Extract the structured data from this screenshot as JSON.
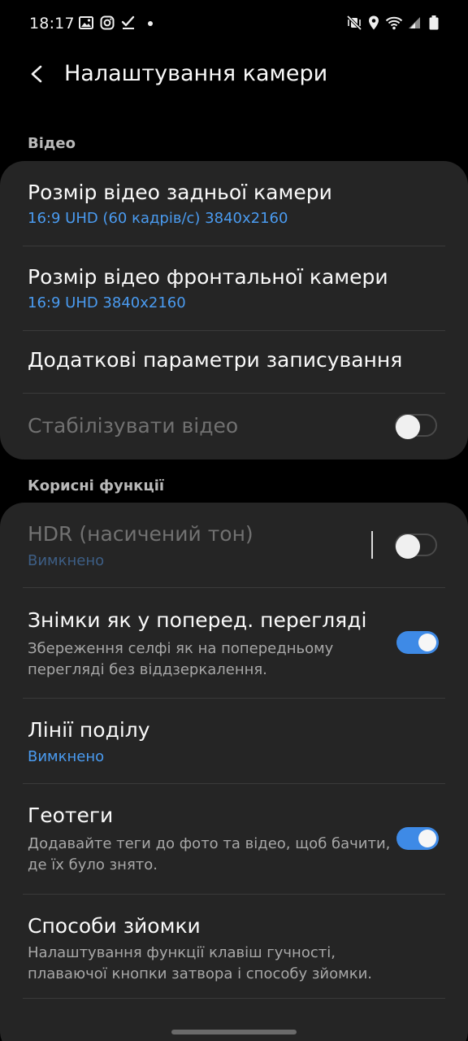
{
  "status_bar": {
    "time": "18:17",
    "left_icons": [
      "image-icon",
      "instagram-icon",
      "check-icon",
      "dot-icon"
    ],
    "right_icons": [
      "mute-vibrate-icon",
      "location-icon",
      "wifi-icon",
      "signal-icon",
      "battery-icon"
    ]
  },
  "header": {
    "back_icon": "arrow-back-icon",
    "title": "Налаштування камери"
  },
  "sections": {
    "video": {
      "label": "Відео",
      "rows": {
        "rear_size": {
          "title": "Розмір відео задньої камери",
          "value": "16:9 UHD (60 кадрів/с) 3840x2160"
        },
        "front_size": {
          "title": "Розмір відео фронтальної камери",
          "value": "16:9 UHD 3840x2160"
        },
        "advanced": {
          "title": "Додаткові параметри записування"
        },
        "stabilize": {
          "title": "Стабілізувати відео",
          "toggle": "off",
          "enabled": false
        }
      }
    },
    "useful": {
      "label": "Корисні функції",
      "rows": {
        "hdr": {
          "title": "HDR (насичений тон)",
          "value": "Вимкнено",
          "toggle": "off",
          "enabled": false
        },
        "preview_pics": {
          "title": "Знімки як у поперед. перегляді",
          "description": "Збереження селфі як на попередньому перегляді без віддзеркалення.",
          "toggle": "on"
        },
        "grid_lines": {
          "title": "Лінії поділу",
          "value": "Вимкнено"
        },
        "geotags": {
          "title": "Геотеги",
          "description": "Додавайте теги до фото та відео, щоб бачити, де їх було знято.",
          "toggle": "on"
        },
        "shooting_methods": {
          "title": "Способи зйомки",
          "description": "Налаштування функції клавіш гучності, плаваючої кнопки затвора і способу зйомки."
        }
      }
    }
  },
  "colors": {
    "background": "#000000",
    "card": "#252525",
    "accent": "#3e8ae6",
    "value_text": "#4a9bf0",
    "description_text": "#a8a8a8",
    "disabled_text": "#717171"
  }
}
